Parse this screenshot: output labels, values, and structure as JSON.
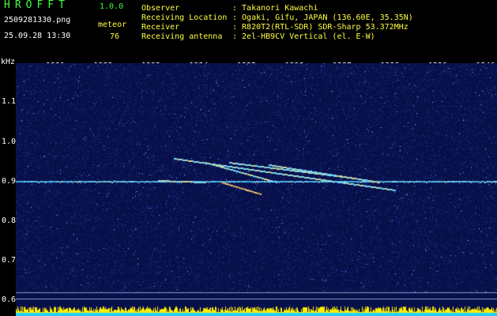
{
  "app": {
    "name": "HROFFT",
    "version": "1.0.0"
  },
  "file": {
    "name": "2509281330.png",
    "datetime": "25.09.28 13:30"
  },
  "meteor": {
    "label": "meteor",
    "count": "76"
  },
  "info": [
    {
      "key": "Observer",
      "value": ": Takanori Kawachi"
    },
    {
      "key": "Receiving Location",
      "value": ": Ogaki, Gifu, JAPAN (136.60E, 35.35N)"
    },
    {
      "key": "Receiver",
      "value": ": R820T2(RTL-SDR) SDR-Sharp 53.372MHz"
    },
    {
      "key": "Receiving antenna",
      "value": ": 2el-HB9CV Vertical (el. E-W)"
    }
  ],
  "axis": {
    "unit": "kHz",
    "x_ticks": [
      "1331",
      "1332",
      "1333",
      "1334",
      "1335",
      "1336",
      "1337",
      "1338",
      "1339",
      "1340"
    ],
    "y_ticks": [
      "1.1",
      "1.0",
      "0.9",
      "0.8",
      "0.7",
      "0.6"
    ]
  },
  "colors": {
    "background": "#08104a",
    "header_green": "#3cff3c",
    "header_yellow": "#ffff40",
    "carrier": "#7fd4ff",
    "noise_floor": "#ffee00"
  }
}
